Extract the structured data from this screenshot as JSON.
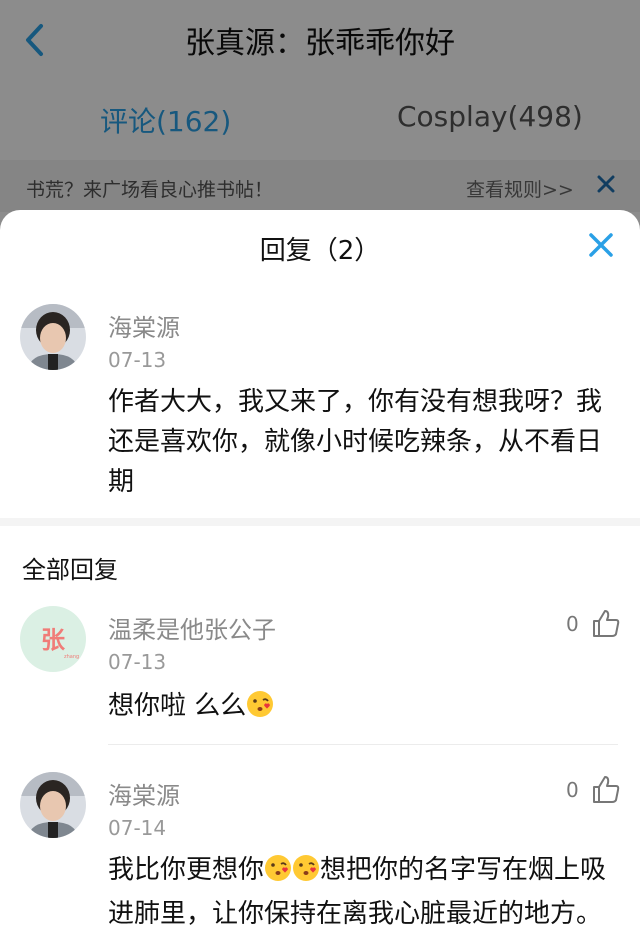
{
  "header": {
    "title": "张真源：张乖乖你好"
  },
  "tabs": [
    {
      "label": "评论(162)"
    },
    {
      "label": "Cosplay(498)"
    }
  ],
  "notice": {
    "text": "书荒？来广场看良心推书帖！",
    "rules_link": "查看规则>>"
  },
  "sheet": {
    "title": "回复（2）",
    "main_comment": {
      "author": "海棠源",
      "date": "07-13",
      "text": "作者大大，我又来了，你有没有想我呀？我还是喜欢你，就像小时候吃辣条，从不看日期"
    },
    "replies_label": "全部回复",
    "replies": [
      {
        "author": "温柔是他张公子",
        "date": "07-13",
        "likes": "0",
        "text_before": "想你啦 么么",
        "text_after": ""
      },
      {
        "author": "海棠源",
        "date": "07-14",
        "likes": "0",
        "text_before": "我比你更想你",
        "text_after": "想把你的名字写在烟上吸进肺里，让你保持在离我心脏最近的地方。"
      }
    ]
  },
  "colors": {
    "accent": "#2aa0e6",
    "overlay": "rgba(0,0,0,0.45)"
  }
}
